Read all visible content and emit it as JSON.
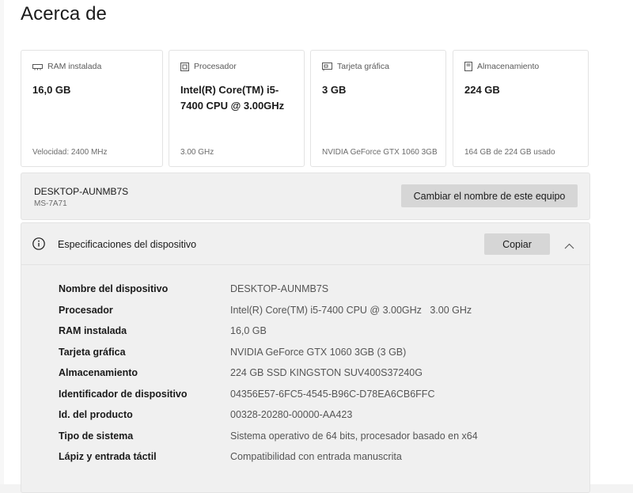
{
  "page": {
    "title": "Acerca de"
  },
  "cards": [
    {
      "icon": "ram-icon",
      "label": "RAM instalada",
      "value": "16,0 GB",
      "footer": "Velocidad: 2400 MHz"
    },
    {
      "icon": "cpu-icon",
      "label": "Procesador",
      "value": "Intel(R) Core(TM) i5-7400 CPU @ 3.00GHz",
      "footer": "3.00 GHz"
    },
    {
      "icon": "gpu-icon",
      "label": "Tarjeta gráfica",
      "value": "3 GB",
      "footer": "NVIDIA GeForce GTX 1060 3GB"
    },
    {
      "icon": "storage-icon",
      "label": "Almacenamiento",
      "value": "224 GB",
      "footer": "164 GB de 224 GB usado"
    }
  ],
  "device": {
    "name": "DESKTOP-AUNMB7S",
    "model": "MS-7A71",
    "rename_label": "Cambiar el nombre de este equipo"
  },
  "specs": {
    "title": "Especificaciones del dispositivo",
    "copy_label": "Copiar",
    "rows": [
      {
        "label": "Nombre del dispositivo",
        "value": "DESKTOP-AUNMB7S"
      },
      {
        "label": "Procesador",
        "value": "Intel(R) Core(TM) i5-7400 CPU @ 3.00GHz   3.00 GHz"
      },
      {
        "label": "RAM instalada",
        "value": "16,0 GB"
      },
      {
        "label": "Tarjeta gráfica",
        "value": "NVIDIA GeForce GTX 1060 3GB (3 GB)"
      },
      {
        "label": "Almacenamiento",
        "value": "224 GB SSD KINGSTON SUV400S37240G"
      },
      {
        "label": "Identificador de dispositivo",
        "value": "04356E57-6FC5-4545-B96C-D78EA6CB6FFC"
      },
      {
        "label": "Id. del producto",
        "value": "00328-20280-00000-AA423"
      },
      {
        "label": "Tipo de sistema",
        "value": "Sistema operativo de 64 bits, procesador basado en x64"
      },
      {
        "label": "Lápiz y entrada táctil",
        "value": "Compatibilidad con entrada manuscrita"
      }
    ]
  }
}
